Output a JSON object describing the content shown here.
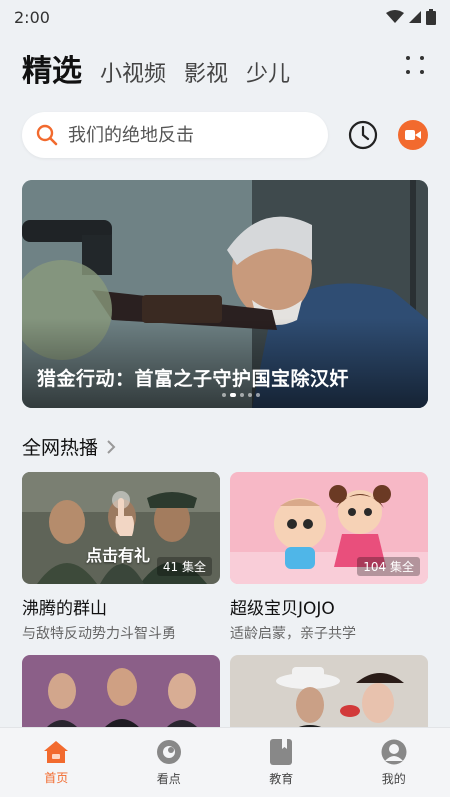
{
  "status_bar": {
    "time": "2:00"
  },
  "top_tabs": [
    "精选",
    "小视频",
    "影视",
    "少儿"
  ],
  "search": {
    "placeholder": "我们的绝地反击"
  },
  "banner": {
    "title": "猎金行动：首富之子守护国宝除汉奸",
    "dots": 5,
    "active_dot": 1
  },
  "section": {
    "title": "全网热播"
  },
  "cards": [
    {
      "title": "沸腾的群山",
      "subtitle": "与敌特反动势力斗智斗勇",
      "count": "41 集全",
      "overlay": "点击有礼"
    },
    {
      "title": "超级宝贝JOJO",
      "subtitle": "适龄启蒙，亲子共学",
      "count": "104 集全"
    }
  ],
  "bottom_nav": [
    {
      "label": "首页",
      "icon": "home-icon",
      "active": true
    },
    {
      "label": "看点",
      "icon": "watch-icon",
      "active": false
    },
    {
      "label": "教育",
      "icon": "book-icon",
      "active": false
    },
    {
      "label": "我的",
      "icon": "profile-icon",
      "active": false
    }
  ],
  "colors": {
    "accent": "#f26a2e",
    "background": "#eef1f4"
  }
}
